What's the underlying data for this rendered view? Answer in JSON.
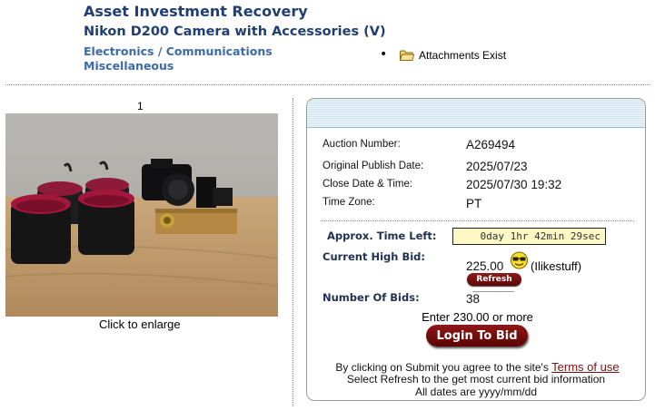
{
  "header": {
    "company": "Asset Investment Recovery",
    "item_title": "Nikon D200 Camera with Accessories (V)",
    "categories": [
      "Electronics / Communications",
      "Miscellaneous"
    ],
    "attachments_text": "Attachments Exist"
  },
  "photo": {
    "number": "1",
    "enlarge_text": "Click to enlarge"
  },
  "auction": {
    "number_label": "Auction Number:",
    "number_value": "A269494",
    "publish_label": "Original Publish Date:",
    "publish_value": "2025/07/23",
    "close_label": "Close Date & Time:",
    "close_value": "2025/07/30 19:32",
    "tz_label": "Time Zone:",
    "tz_value": "PT"
  },
  "bid": {
    "time_left_label": "Approx. Time Left:",
    "time_left_value": "0day 1hr 42min 29sec",
    "high_bid_label": "Current High Bid:",
    "high_bid_value": "225.00",
    "high_bidder": "(Ilikestuff)",
    "refresh_label": "Refresh",
    "num_bids_label": "Number Of Bids:",
    "num_bids_value": "38",
    "enter_text": "Enter 230.00 or more",
    "login_label": "Login To Bid"
  },
  "footer": {
    "line1_prefix": "By clicking on Submit you agree to the site's",
    "terms_link": "Terms of use",
    "line2": "Select Refresh to the get most current bid information",
    "line3": "All dates are yyyy/mm/dd"
  },
  "colors": {
    "title": "#1f3f74",
    "category_link": "#3b6aa8",
    "button": "#7a0d0d",
    "timer_bg": "#fdf9c5",
    "panel_band": "#cfe4ee"
  }
}
